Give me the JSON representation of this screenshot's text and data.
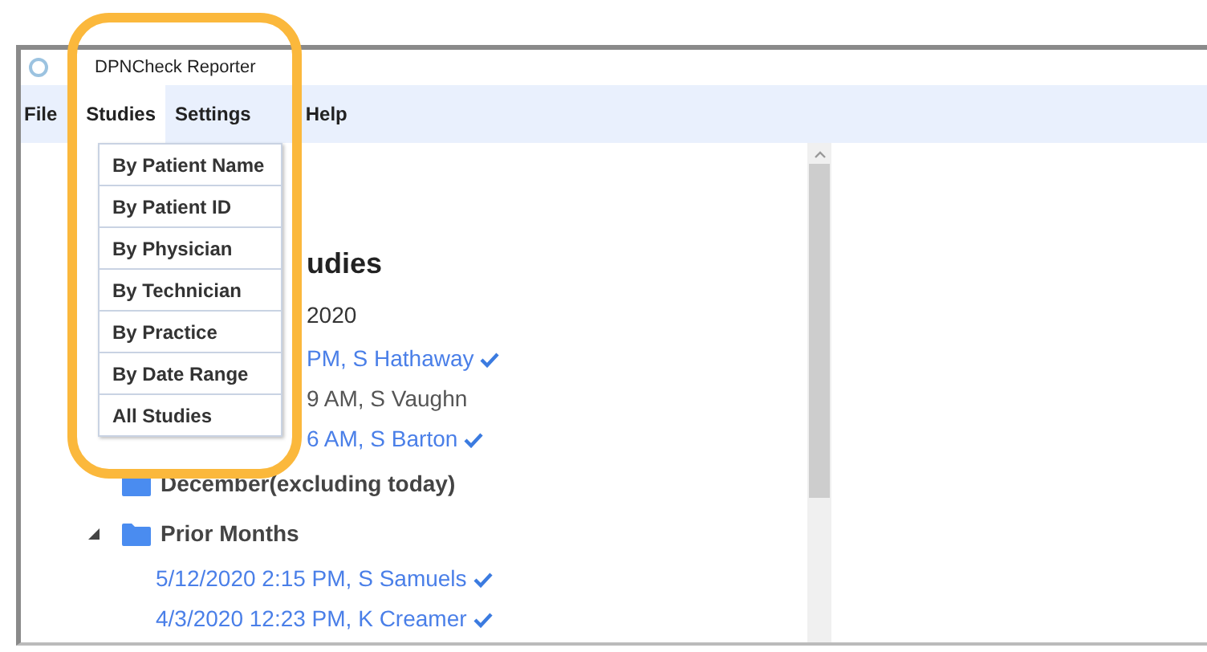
{
  "window": {
    "title": "DPNCheck Reporter"
  },
  "menu": [
    {
      "label": "File",
      "selected": false
    },
    {
      "label": "Studies",
      "selected": true
    },
    {
      "label": "Settings",
      "selected": false
    },
    {
      "label": "Help",
      "selected": false
    }
  ],
  "dropdown": [
    "By Patient Name",
    "By Patient ID",
    "By Physician",
    "By Technician",
    "By Practice",
    "By Date Range",
    "All Studies"
  ],
  "tree": {
    "heading": "udies",
    "groups": [
      {
        "kind": "date",
        "label": "2020",
        "children": [
          {
            "text": "PM, S Hathaway",
            "checked": true
          },
          {
            "text": "9 AM, S Vaughn",
            "checked": false
          },
          {
            "text": "6 AM, S Barton",
            "checked": true
          }
        ]
      },
      {
        "kind": "folder",
        "label": "December(excluding today)",
        "expanded": false
      },
      {
        "kind": "folder",
        "label": "Prior Months",
        "expanded": true,
        "children": [
          {
            "text": "5/12/2020 2:15 PM, S Samuels",
            "checked": true
          },
          {
            "text": "4/3/2020 12:23 PM, K Creamer",
            "checked": true
          }
        ]
      }
    ]
  }
}
